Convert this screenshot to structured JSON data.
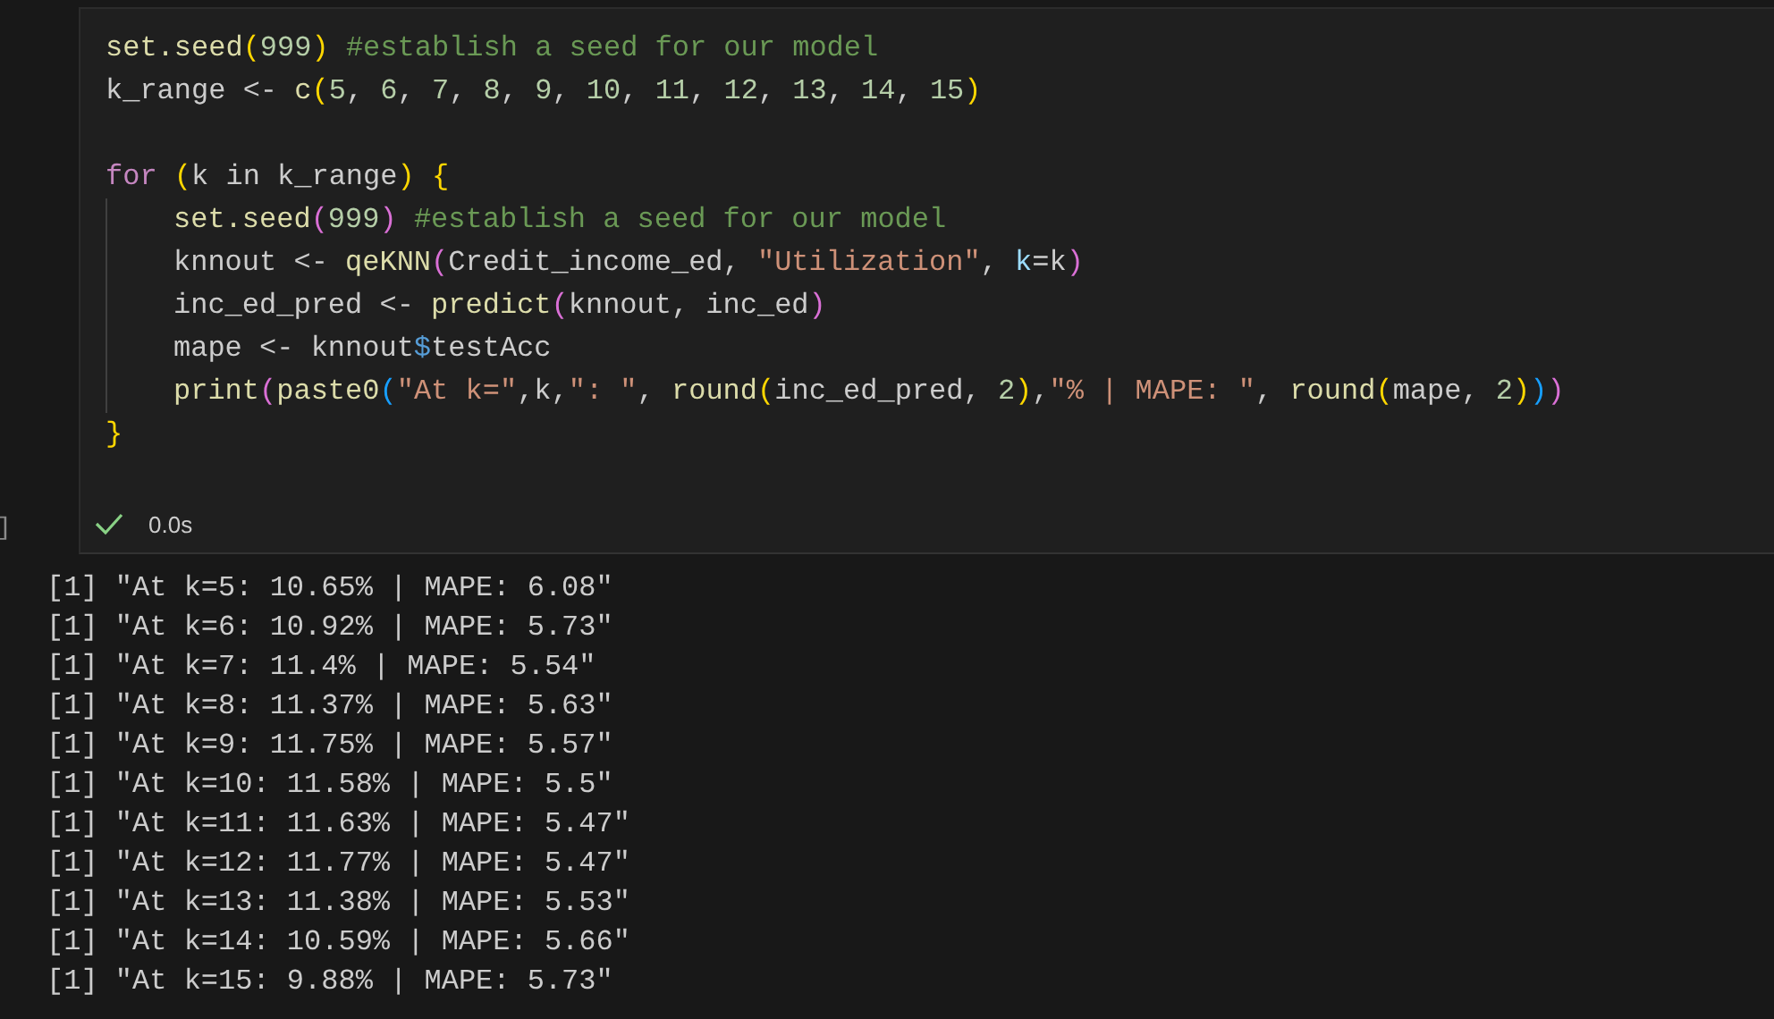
{
  "cell": {
    "prompt": "]",
    "code": [
      {
        "kind": "code",
        "tokens": [
          {
            "text": "set.seed",
            "kind": "func"
          },
          {
            "text": "(",
            "kind": "b1"
          },
          {
            "text": "999",
            "kind": "number"
          },
          {
            "text": ")",
            "kind": "b1"
          },
          {
            "text": " #establish a seed for our model",
            "kind": "comment"
          }
        ]
      },
      {
        "kind": "code",
        "tokens": [
          {
            "text": "k_range <- ",
            "kind": "plain"
          },
          {
            "text": "c",
            "kind": "func"
          },
          {
            "text": "(",
            "kind": "b1"
          },
          {
            "text": "5",
            "kind": "number"
          },
          {
            "text": ", ",
            "kind": "plain"
          },
          {
            "text": "6",
            "kind": "number"
          },
          {
            "text": ", ",
            "kind": "plain"
          },
          {
            "text": "7",
            "kind": "number"
          },
          {
            "text": ", ",
            "kind": "plain"
          },
          {
            "text": "8",
            "kind": "number"
          },
          {
            "text": ", ",
            "kind": "plain"
          },
          {
            "text": "9",
            "kind": "number"
          },
          {
            "text": ", ",
            "kind": "plain"
          },
          {
            "text": "10",
            "kind": "number"
          },
          {
            "text": ", ",
            "kind": "plain"
          },
          {
            "text": "11",
            "kind": "number"
          },
          {
            "text": ", ",
            "kind": "plain"
          },
          {
            "text": "12",
            "kind": "number"
          },
          {
            "text": ", ",
            "kind": "plain"
          },
          {
            "text": "13",
            "kind": "number"
          },
          {
            "text": ", ",
            "kind": "plain"
          },
          {
            "text": "14",
            "kind": "number"
          },
          {
            "text": ", ",
            "kind": "plain"
          },
          {
            "text": "15",
            "kind": "number"
          },
          {
            "text": ")",
            "kind": "b1"
          }
        ]
      },
      {
        "kind": "blank"
      },
      {
        "kind": "code",
        "tokens": [
          {
            "text": "for",
            "kind": "keyword"
          },
          {
            "text": " (",
            "kind": "b1"
          },
          {
            "text": "k in k_range",
            "kind": "plain"
          },
          {
            "text": ")",
            "kind": "b1"
          },
          {
            "text": " {",
            "kind": "b1"
          }
        ],
        "children": [
          {
            "kind": "code",
            "tokens": [
              {
                "text": "set.seed",
                "kind": "func"
              },
              {
                "text": "(",
                "kind": "b2"
              },
              {
                "text": "999",
                "kind": "number"
              },
              {
                "text": ")",
                "kind": "b2"
              },
              {
                "text": " #establish a seed for our model",
                "kind": "comment"
              }
            ]
          },
          {
            "kind": "code",
            "tokens": [
              {
                "text": "knnout <- ",
                "kind": "plain"
              },
              {
                "text": "qeKNN",
                "kind": "func"
              },
              {
                "text": "(",
                "kind": "b2"
              },
              {
                "text": "Credit_income_ed, ",
                "kind": "plain"
              },
              {
                "text": "\"Utilization\"",
                "kind": "string"
              },
              {
                "text": ", ",
                "kind": "plain"
              },
              {
                "text": "k",
                "kind": "param"
              },
              {
                "text": "=k",
                "kind": "plain"
              },
              {
                "text": ")",
                "kind": "b2"
              }
            ]
          },
          {
            "kind": "code",
            "tokens": [
              {
                "text": "inc_ed_pred <- ",
                "kind": "plain"
              },
              {
                "text": "predict",
                "kind": "func"
              },
              {
                "text": "(",
                "kind": "b2"
              },
              {
                "text": "knnout, inc_ed",
                "kind": "plain"
              },
              {
                "text": ")",
                "kind": "b2"
              }
            ]
          },
          {
            "kind": "code",
            "tokens": [
              {
                "text": "mape <- knnout",
                "kind": "plain"
              },
              {
                "text": "$",
                "kind": "op"
              },
              {
                "text": "testAcc",
                "kind": "plain"
              }
            ]
          },
          {
            "kind": "code",
            "tokens": [
              {
                "text": "print",
                "kind": "func"
              },
              {
                "text": "(",
                "kind": "b2"
              },
              {
                "text": "paste0",
                "kind": "func"
              },
              {
                "text": "(",
                "kind": "b3"
              },
              {
                "text": "\"At k=\"",
                "kind": "string"
              },
              {
                "text": ",k,",
                "kind": "plain"
              },
              {
                "text": "\": \"",
                "kind": "string"
              },
              {
                "text": ", ",
                "kind": "plain"
              },
              {
                "text": "round",
                "kind": "func"
              },
              {
                "text": "(",
                "kind": "b1"
              },
              {
                "text": "inc_ed_pred, ",
                "kind": "plain"
              },
              {
                "text": "2",
                "kind": "number"
              },
              {
                "text": ")",
                "kind": "b1"
              },
              {
                "text": ",",
                "kind": "plain"
              },
              {
                "text": "\"% | MAPE: \"",
                "kind": "string"
              },
              {
                "text": ", ",
                "kind": "plain"
              },
              {
                "text": "round",
                "kind": "func"
              },
              {
                "text": "(",
                "kind": "b1"
              },
              {
                "text": "mape, ",
                "kind": "plain"
              },
              {
                "text": "2",
                "kind": "number"
              },
              {
                "text": ")",
                "kind": "b1"
              },
              {
                "text": ")",
                "kind": "b3"
              },
              {
                "text": ")",
                "kind": "b2"
              }
            ]
          }
        ]
      },
      {
        "kind": "code",
        "tokens": [
          {
            "text": "}",
            "kind": "b1"
          }
        ]
      }
    ],
    "status": {
      "succeeded": true,
      "duration": "0.0s"
    }
  },
  "output": [
    "[1] \"At k=5: 10.65% | MAPE: 6.08\"",
    "[1] \"At k=6: 10.92% | MAPE: 5.73\"",
    "[1] \"At k=7: 11.4% | MAPE: 5.54\"",
    "[1] \"At k=8: 11.37% | MAPE: 5.63\"",
    "[1] \"At k=9: 11.75% | MAPE: 5.57\"",
    "[1] \"At k=10: 11.58% | MAPE: 5.5\"",
    "[1] \"At k=11: 11.63% | MAPE: 5.47\"",
    "[1] \"At k=12: 11.77% | MAPE: 5.47\"",
    "[1] \"At k=13: 11.38% | MAPE: 5.53\"",
    "[1] \"At k=14: 10.59% | MAPE: 5.66\"",
    "[1] \"At k=15: 9.88% | MAPE: 5.73\""
  ]
}
